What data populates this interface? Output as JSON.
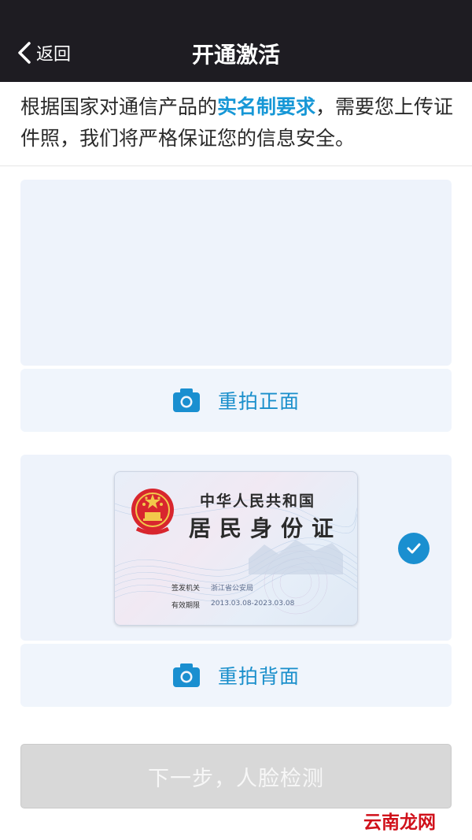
{
  "header": {
    "back_label": "返回",
    "title": "开通激活"
  },
  "notice": {
    "text_before": "根据国家对通信产品的",
    "link": "实名制要求",
    "text_after": "，需要您上传证件照，我们将严格保证您的信息安全。"
  },
  "front": {
    "retake_label": "重拍正面",
    "icon": "camera-icon"
  },
  "back": {
    "retake_label": "重拍背面",
    "icon": "camera-icon",
    "status_icon": "check-circle-icon",
    "id_card": {
      "country": "中华人民共和国",
      "title": "居民身份证",
      "issuer_label": "签发机关",
      "issuer_value": "浙江省公安局",
      "validity_label": "有效期限",
      "validity_value": "2013.03.08-2023.03.08"
    }
  },
  "next_button": {
    "label": "下一步，人脸检测",
    "enabled": false
  },
  "watermark": "云南龙网",
  "colors": {
    "header_bg": "#1e1c22",
    "accent": "#1a8fd0",
    "panel_bg": "#eef3fb",
    "button_disabled": "#d8d8d8",
    "watermark": "#d0101a"
  }
}
